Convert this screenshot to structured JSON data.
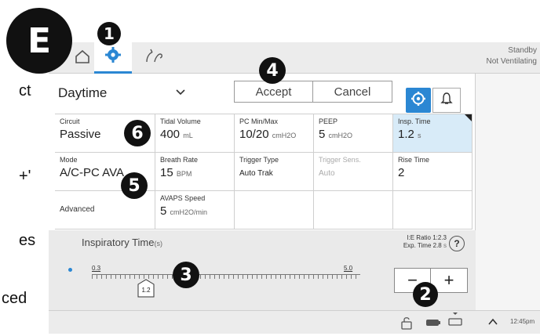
{
  "side_text": [
    "ct",
    "+'",
    "es",
    "ced"
  ],
  "section_badge": "E",
  "callouts": [
    "1",
    "2",
    "3",
    "4",
    "5",
    "6"
  ],
  "tabs": [
    {
      "icon": "home-icon"
    },
    {
      "icon": "gear-icon",
      "active": true
    },
    {
      "icon": "patient-icon"
    }
  ],
  "status": {
    "line1": "Standby",
    "line2": "Not Ventilating"
  },
  "schedule": {
    "value": "Daytime"
  },
  "actions": {
    "accept": "Accept",
    "cancel": "Cancel"
  },
  "params": {
    "circuit": {
      "label": "Circuit",
      "value": "Passive"
    },
    "tidal_volume": {
      "label": "Tidal Volume",
      "value": "400",
      "unit": "mL"
    },
    "pc_minmax": {
      "label": "PC Min/Max",
      "value": "10/20",
      "unit": "cmH2O"
    },
    "peep": {
      "label": "PEEP",
      "value": "5",
      "unit": "cmH2O"
    },
    "insp_time": {
      "label": "Insp. Time",
      "value": "1.2",
      "unit": "s"
    },
    "mode": {
      "label": "Mode",
      "value": "A/C-PC AVA"
    },
    "breath_rate": {
      "label": "Breath Rate",
      "value": "15",
      "unit": "BPM"
    },
    "trigger_type": {
      "label": "Trigger Type",
      "value": "Auto Trak"
    },
    "trigger_sens": {
      "label": "Trigger Sens.",
      "value": "Auto"
    },
    "rise_time": {
      "label": "Rise Time",
      "value": "2"
    },
    "advanced": {
      "label": "Advanced"
    },
    "avaps_speed": {
      "label": "AVAPS Speed",
      "value": "5",
      "unit": "cmH2O/min"
    }
  },
  "slider": {
    "title": "Inspiratory Time",
    "unit": "(s)",
    "min": "0.3",
    "max": "5.0",
    "value": "1.2",
    "value_fraction": 0.191,
    "ie_ratio": "I:E Ratio 1:2.3",
    "exp_time": "Exp. Time 2.8",
    "exp_unit": "s",
    "help": "?",
    "minus": "−",
    "plus": "+"
  },
  "clock": "12:45pm"
}
